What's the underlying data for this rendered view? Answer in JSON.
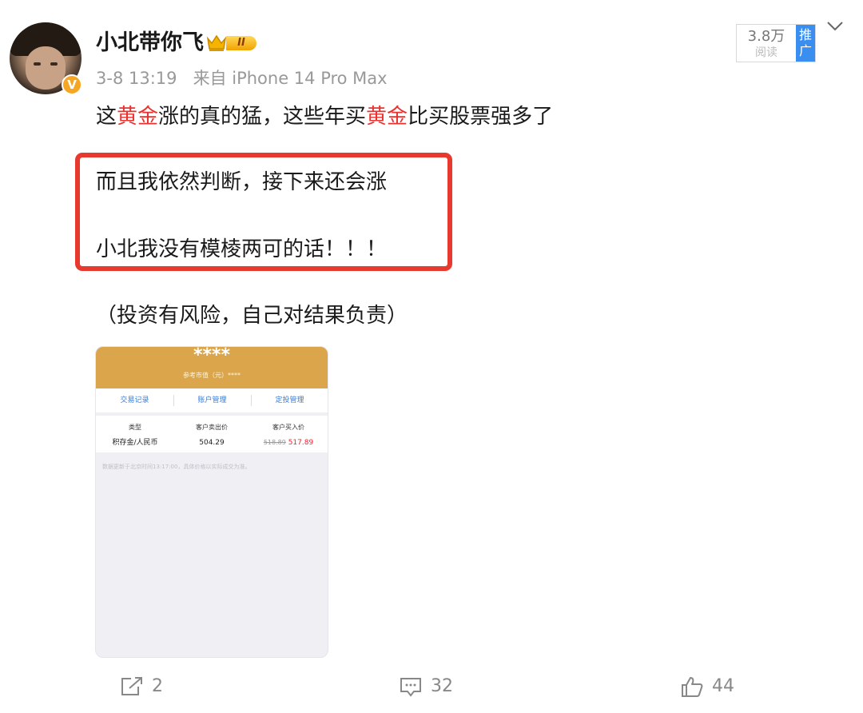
{
  "post": {
    "username": "小北带你飞",
    "level_badge": "II",
    "timestamp": "3-8 13:19",
    "source": "来自 iPhone 14 Pro Max",
    "read_count": "3.8万",
    "read_label": "阅读",
    "promo_label": "推广",
    "line1_parts": [
      "这",
      "黄金",
      "涨的真的猛，这些年买",
      "黄金",
      "比买股票强多了"
    ],
    "line2": "而且我依然判断，接下来还会涨",
    "line3": "小北我没有模棱两可的话！！！",
    "line4": "（投资有风险，自己对结果负责）",
    "accent_red": "#e8322f",
    "box_red": "#e8392e"
  },
  "attached_image": {
    "masked_balance": "****",
    "ref_label": "参考市值（元）****",
    "tabs": [
      "交易记录",
      "账户管理",
      "定投管理"
    ],
    "columns": [
      "类型",
      "客户卖出价",
      "客户买入价"
    ],
    "row": {
      "type": "积存金/人民币",
      "sell": "504.29",
      "buy_old": "518.89",
      "buy_new": "517.89"
    },
    "note": "数据更新于北京时间13:17:00，具体价格以实际成交为准。",
    "header_color": "#dba64b"
  },
  "actions": {
    "share_count": "2",
    "comment_count": "32",
    "like_count": "44",
    "icons": [
      "share-icon",
      "comment-icon",
      "like-icon"
    ]
  }
}
